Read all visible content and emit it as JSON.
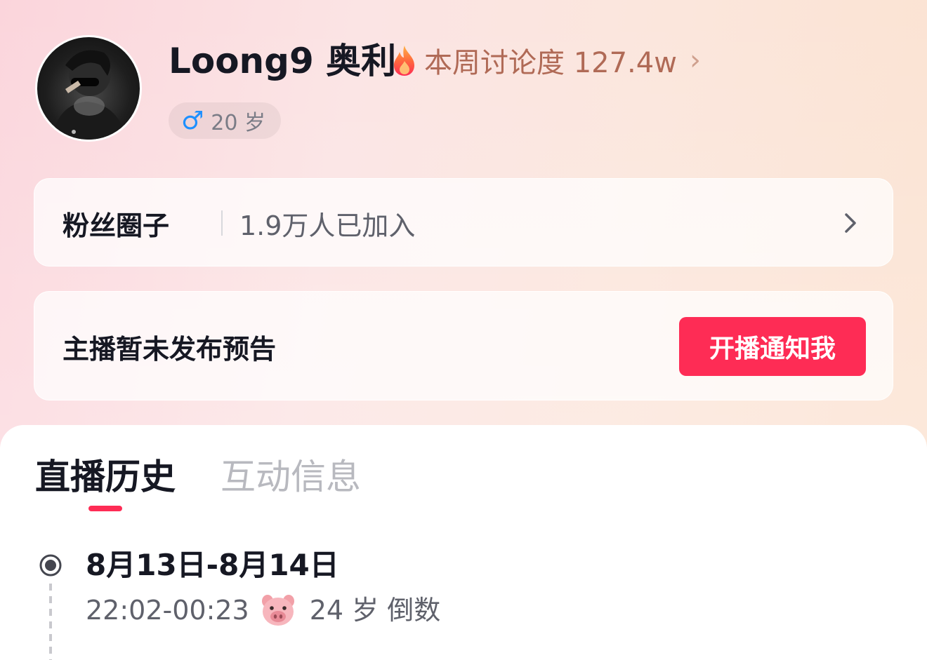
{
  "profile": {
    "username": "Loong9 奥利",
    "heat_text": "本周讨论度 127.4w",
    "heat_arrow": "›",
    "gender_symbol": "♂",
    "age_text": "20 岁"
  },
  "fans_circle": {
    "title": "粉丝圈子",
    "count_text": "1.9万人已加入"
  },
  "notice": {
    "text": "主播暂未发布预告",
    "button_label": "开播通知我"
  },
  "tabs": [
    {
      "label": "直播历史",
      "active": true
    },
    {
      "label": "互动信息",
      "active": false
    }
  ],
  "history": [
    {
      "date_range": "8月13日-8月14日",
      "time_range": "22:02-00:23",
      "emoji": "pig-face-icon",
      "title": "24 岁 倒数"
    }
  ],
  "colors": {
    "accent": "#fe2c55",
    "heat_text": "#b06a56",
    "male_blue": "#1e90ff"
  }
}
